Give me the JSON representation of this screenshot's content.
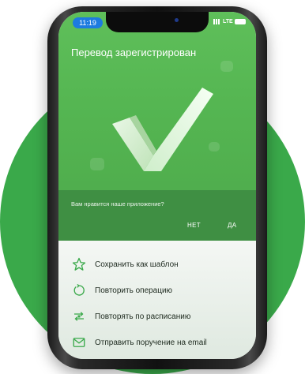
{
  "status_bar": {
    "time": "11:19",
    "network": "LTE"
  },
  "screen": {
    "title": "Перевод зарегистрирован",
    "rating_question": "Вам нравится наше приложение?",
    "no_label": "НЕТ",
    "yes_label": "ДА"
  },
  "actions": [
    {
      "label": "Сохранить как шаблон",
      "icon": "star-icon"
    },
    {
      "label": "Повторить операцию",
      "icon": "repeat-icon"
    },
    {
      "label": "Повторять по расписанию",
      "icon": "schedule-icon"
    },
    {
      "label": "Отправить поручение на email",
      "icon": "email-icon"
    }
  ],
  "colors": {
    "brand_green": "#3aa94a",
    "header_green": "#55b652",
    "icon_green": "#3aa94a"
  }
}
